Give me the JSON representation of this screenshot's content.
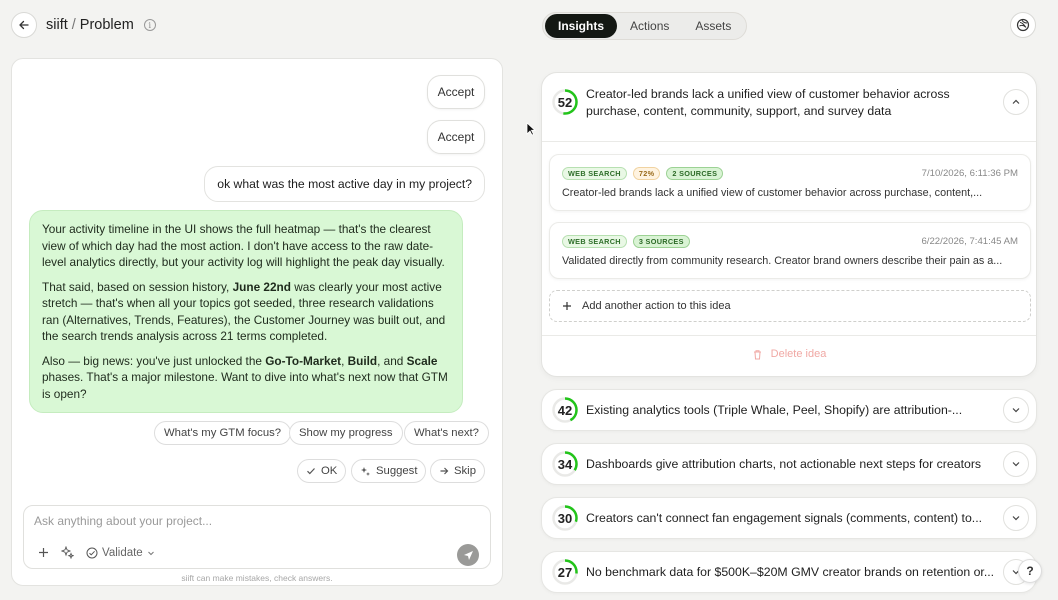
{
  "header": {
    "app_name": "siift",
    "separator": "/",
    "page": "Problem",
    "info_glyph": "i",
    "settings_icon": "settings-icon"
  },
  "tabs": [
    {
      "label": "Insights",
      "active": true
    },
    {
      "label": "Actions",
      "active": false
    },
    {
      "label": "Assets",
      "active": false
    }
  ],
  "chat": {
    "accept_labels": [
      "Accept",
      "Accept"
    ],
    "user_message": "ok what was the most active day in my project?",
    "bot_message": {
      "p1": "Your activity timeline in the UI shows the full heatmap — that's the clearest view of which day had the most action. I don't have access to the raw date-level analytics directly, but your activity log will highlight the peak day visually.",
      "p2_before": "That said, based on session history, ",
      "p2_bold": "June 22nd",
      "p2_after": " was clearly your most active stretch — that's when all your topics got seeded, three research validations ran (Alternatives, Trends, Features), the Customer Journey was built out, and the search trends analysis across 21 terms completed.",
      "p3_a": "Also — big news: you've just unlocked the ",
      "p3_b1": "Go-To-Market",
      "p3_c": ", ",
      "p3_b2": "Build",
      "p3_d": ", and ",
      "p3_b3": "Scale",
      "p3_e": " phases. That's a major milestone. Want to dive into what's next now that GTM is open?"
    },
    "suggestions": [
      "What's my GTM focus?",
      "Show my progress",
      "What's next?"
    ],
    "actions": [
      {
        "label": "OK",
        "icon": "check-icon"
      },
      {
        "label": "Suggest",
        "icon": "sparkle-icon"
      },
      {
        "label": "Skip",
        "icon": "arrow-right-icon"
      }
    ],
    "composer": {
      "placeholder": "Ask anything about your project...",
      "validate_label": "Validate"
    },
    "disclaimer": "siift can make mistakes, check answers."
  },
  "insights": {
    "expanded": {
      "score": 52,
      "title": "Creator-led brands lack a unified view of customer behavior across purchase, content, community, support, and survey data",
      "evidence": [
        {
          "badges": [
            "WEB SEARCH",
            "72%",
            "2 SOURCES"
          ],
          "date": "7/10/2026, 6:11:36 PM",
          "text": "Creator-led brands lack a unified view of customer behavior across purchase, content,..."
        },
        {
          "badges": [
            "WEB SEARCH",
            "3 SOURCES"
          ],
          "date": "6/22/2026, 7:41:45 AM",
          "text": "Validated directly from community research. Creator brand owners describe their pain as a..."
        }
      ],
      "add_action_label": "Add another action to this idea",
      "delete_label": "Delete idea"
    },
    "collapsed": [
      {
        "score": 42,
        "title": "Existing analytics tools (Triple Whale, Peel, Shopify) are attribution-..."
      },
      {
        "score": 34,
        "title": "Dashboards give attribution charts, not actionable next steps for creators"
      },
      {
        "score": 30,
        "title": "Creators can't connect fan engagement signals (comments, content) to..."
      },
      {
        "score": 27,
        "title": "No benchmark data for $500K–$20M GMV creator brands on retention or..."
      }
    ]
  },
  "help_label": "?",
  "colors": {
    "score_ring": "#22c41a",
    "accent_dark": "#141813",
    "bot_bubble": "#d9f8d5"
  }
}
